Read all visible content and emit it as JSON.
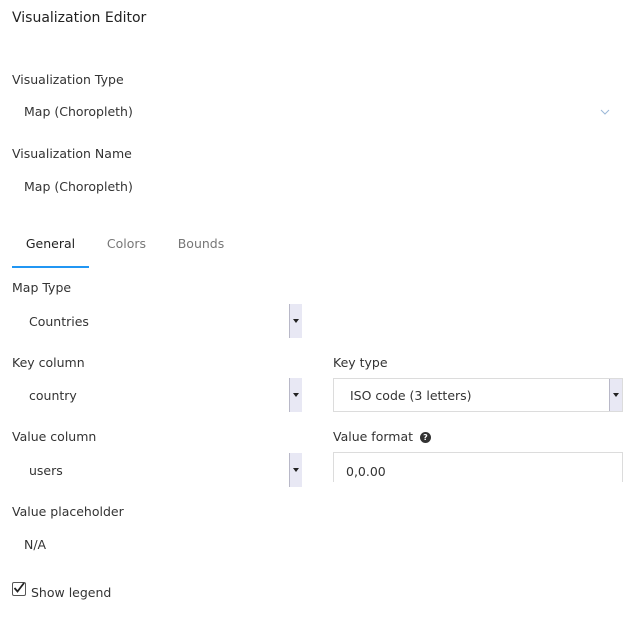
{
  "editor": {
    "title": "Visualization Editor"
  },
  "viz_type": {
    "label": "Visualization Type",
    "value": "Map (Choropleth)"
  },
  "viz_name": {
    "label": "Visualization Name",
    "value": "Map (Choropleth)"
  },
  "tabs": [
    {
      "label": "General",
      "active": true
    },
    {
      "label": "Colors",
      "active": false
    },
    {
      "label": "Bounds",
      "active": false
    }
  ],
  "general": {
    "map_type": {
      "label": "Map Type",
      "value": "Countries"
    },
    "key_column": {
      "label": "Key column",
      "value": "country"
    },
    "key_type": {
      "label": "Key type",
      "value": "ISO code (3 letters)"
    },
    "value_column": {
      "label": "Value column",
      "value": "users"
    },
    "value_format": {
      "label": "Value format",
      "value": "0,0.00",
      "help_icon": "question-circle-icon"
    },
    "value_placeholder": {
      "label": "Value placeholder",
      "value": "N/A"
    },
    "show_legend": {
      "label": "Show legend",
      "checked": true
    }
  },
  "colors": {
    "accent": "#2196f3",
    "select_button": "#e8e8f4"
  }
}
